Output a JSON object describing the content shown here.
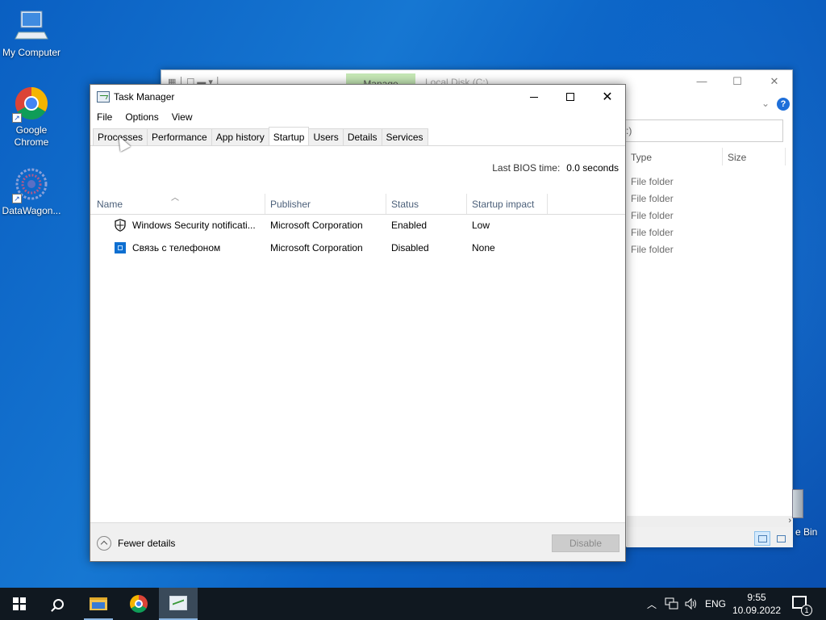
{
  "desktop": {
    "icons": [
      {
        "label": "My Computer"
      },
      {
        "label": "Google Chrome"
      },
      {
        "label": "DataWagon..."
      }
    ],
    "recycle_label": "e Bin"
  },
  "explorer": {
    "manage_tab": "Manage",
    "path": "Local Disk (C:)",
    "search_fragment": ":)",
    "columns": [
      "Type",
      "Size"
    ],
    "rows": [
      "File folder",
      "File folder",
      "File folder",
      "File folder",
      "File folder"
    ]
  },
  "task_manager": {
    "title": "Task Manager",
    "menu": [
      "File",
      "Options",
      "View"
    ],
    "tabs": [
      "Processes",
      "Performance",
      "App history",
      "Startup",
      "Users",
      "Details",
      "Services"
    ],
    "active_tab": "Startup",
    "bios_label": "Last BIOS time:",
    "bios_value": "0.0 seconds",
    "columns": [
      "Name",
      "Publisher",
      "Status",
      "Startup impact"
    ],
    "rows": [
      {
        "icon": "shield-icon",
        "name": "Windows Security notificati...",
        "publisher": "Microsoft Corporation",
        "status": "Enabled",
        "impact": "Low"
      },
      {
        "icon": "phone-link-icon",
        "name": "Связь с телефоном",
        "publisher": "Microsoft Corporation",
        "status": "Disabled",
        "impact": "None"
      }
    ],
    "fewer_details": "Fewer details",
    "disable_button": "Disable"
  },
  "taskbar": {
    "language": "ENG",
    "time": "9:55",
    "date": "10.09.2022",
    "notification_count": "1"
  }
}
